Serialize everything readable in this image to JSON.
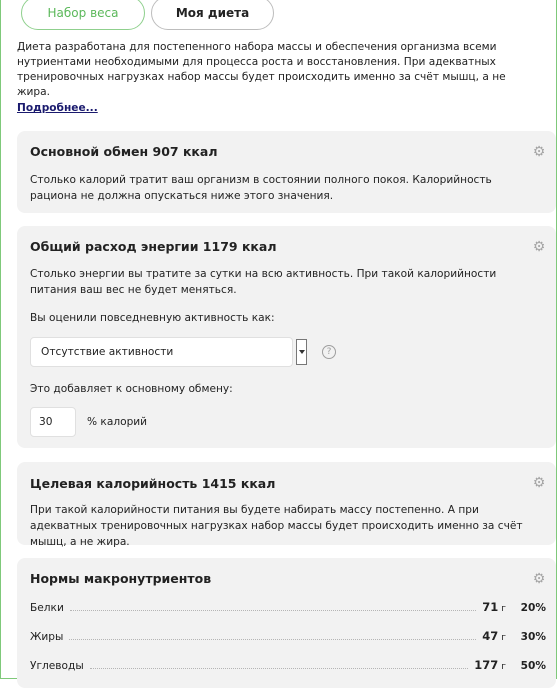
{
  "tabs": [
    {
      "label": "Набор веса",
      "active": true
    },
    {
      "label": "Моя диета",
      "active": false
    }
  ],
  "intro": {
    "text": "Диета разработана для постепенного набора массы и обеспечения организма всеми нутриентами необходимыми для процесса роста и восстановления. При адекватных тренировочных нагрузках набор массы будет происходить именно за счёт мышц, а не жира.",
    "more_link": "Подробнее..."
  },
  "basal": {
    "title": "Основной обмен 907 ккал",
    "text": "Столько калорий тратит ваш организм в состоянии полного покоя. Калорийность рациона не должна опускаться ниже этого значения."
  },
  "expenditure": {
    "title": "Общий расход энергии 1179 ккал",
    "text": "Столько энергии вы тратите за сутки на всю активность. При такой калорийности питания ваш вес не будет меняться.",
    "activity_label": "Вы оценили повседневную активность как:",
    "activity_value": "Отсутствие активности",
    "adds_label": "Это добавляет к основному обмену:",
    "percent_value": "30",
    "percent_unit": "% калорий"
  },
  "target": {
    "title": "Целевая калорийность 1415 ккал",
    "text": "При такой калорийности питания вы будете набирать массу постепенно. А при адекватных тренировочных нагрузках набор массы будет происходить именно за счёт мышц, а не жира."
  },
  "macros": {
    "title": "Нормы макронутриентов",
    "rows": [
      {
        "name": "Белки",
        "value": "71",
        "unit": "г",
        "pct": "20%"
      },
      {
        "name": "Жиры",
        "value": "47",
        "unit": "г",
        "pct": "30%"
      },
      {
        "name": "Углеводы",
        "value": "177",
        "unit": "г",
        "pct": "50%"
      }
    ]
  },
  "colors": {
    "accent_green": "#5bb85a",
    "card_bg": "#f2f2f2",
    "link": "#1a1a6e"
  }
}
